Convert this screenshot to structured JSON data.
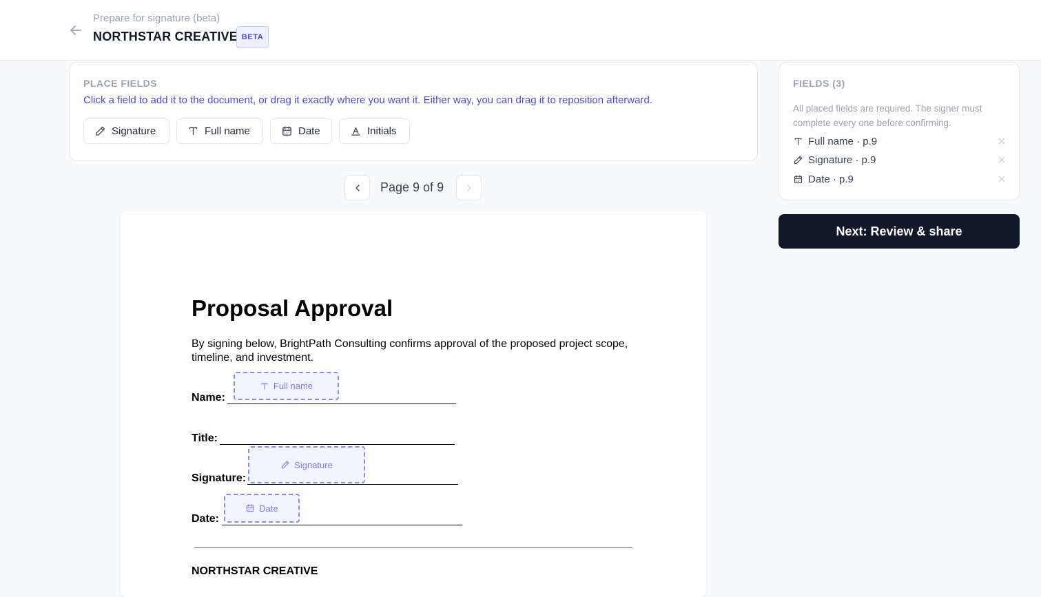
{
  "header": {
    "subtitle": "Prepare for signature (beta)",
    "title": "NORTHSTAR CREATIVE",
    "badge": "BETA"
  },
  "place_fields": {
    "heading": "PLACE FIELDS",
    "description": "Click a field to add it to the document, or drag it exactly where you want it. Either way, you can drag it to reposition afterward.",
    "buttons": [
      {
        "label": "Signature",
        "icon": "pen-icon"
      },
      {
        "label": "Full name",
        "icon": "text-icon"
      },
      {
        "label": "Date",
        "icon": "calendar-icon"
      },
      {
        "label": "Initials",
        "icon": "initials-icon"
      }
    ]
  },
  "pager": {
    "label": "Page 9 of 9",
    "current": 9,
    "total": 9
  },
  "document": {
    "title": "Proposal Approval",
    "body": "By signing below, BrightPath Consulting confirms approval of the proposed project scope, timeline, and investment.",
    "labels": {
      "name": "Name:",
      "title": "Title:",
      "signature": "Signature:",
      "date": "Date:"
    },
    "company": "NORTHSTAR CREATIVE",
    "placed_fields": {
      "full_name": "Full name",
      "signature": "Signature",
      "date": "Date"
    }
  },
  "fields_panel": {
    "heading": "FIELDS (3)",
    "note": "All placed fields are required. The signer must complete every one before confirming.",
    "items": [
      {
        "label": "Full name · p.9",
        "icon": "text-icon"
      },
      {
        "label": "Signature · p.9",
        "icon": "pen-icon"
      },
      {
        "label": "Date · p.9",
        "icon": "calendar-icon"
      }
    ]
  },
  "next_button": "Next: Review & share",
  "colors": {
    "accent": "#4f46e5",
    "placed_border": "#8b87f0",
    "primary_button": "#111827"
  }
}
